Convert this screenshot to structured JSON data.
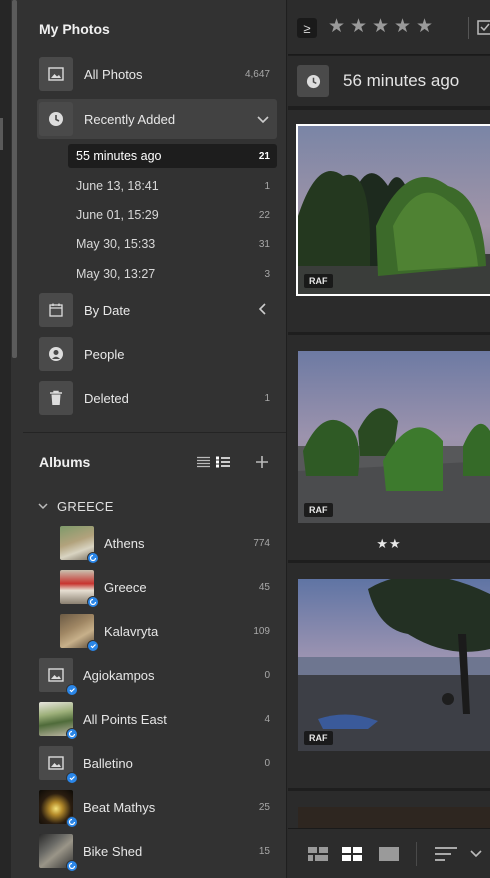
{
  "sidebar": {
    "my_photos_title": "My Photos",
    "nav": [
      {
        "label": "All Photos",
        "count": "4,647",
        "icon": "image-icon"
      },
      {
        "label": "Recently Added",
        "count": "",
        "icon": "clock-icon"
      },
      {
        "label": "By Date",
        "count": "",
        "icon": "calendar-icon"
      },
      {
        "label": "People",
        "count": "",
        "icon": "person-icon"
      },
      {
        "label": "Deleted",
        "count": "1",
        "icon": "trash-icon"
      }
    ],
    "recent": [
      {
        "label": "55 minutes ago",
        "count": "21"
      },
      {
        "label": "June 13, 18:41",
        "count": "1"
      },
      {
        "label": "June 01, 15:29",
        "count": "22"
      },
      {
        "label": "May 30, 15:33",
        "count": "31"
      },
      {
        "label": "May 30, 13:27",
        "count": "3"
      }
    ],
    "albums_title": "Albums",
    "group": {
      "label": "GREECE"
    },
    "albums": [
      {
        "label": "Athens",
        "count": "774"
      },
      {
        "label": "Greece",
        "count": "45"
      },
      {
        "label": "Kalavryta",
        "count": "109"
      },
      {
        "label": "Agiokampos",
        "count": "0"
      },
      {
        "label": "All Points East",
        "count": "4"
      },
      {
        "label": "Balletino",
        "count": "0"
      },
      {
        "label": "Beat Mathys",
        "count": "25"
      },
      {
        "label": "Bike Shed",
        "count": "15"
      }
    ]
  },
  "toolbar": {
    "filter_symbol": "≥",
    "stars": [
      "★",
      "★",
      "★",
      "★",
      "★"
    ]
  },
  "main": {
    "date_header": "56 minutes ago",
    "photos": [
      {
        "badge": "RAF",
        "rating": ""
      },
      {
        "badge": "RAF",
        "rating": "★★"
      },
      {
        "badge": "RAF",
        "rating": ""
      }
    ]
  },
  "colors": {
    "accent_blue": "#2a86e8",
    "sidebar_bg": "#323232",
    "selected_row": "#424242",
    "selected_subrow": "#1d1d1d"
  }
}
